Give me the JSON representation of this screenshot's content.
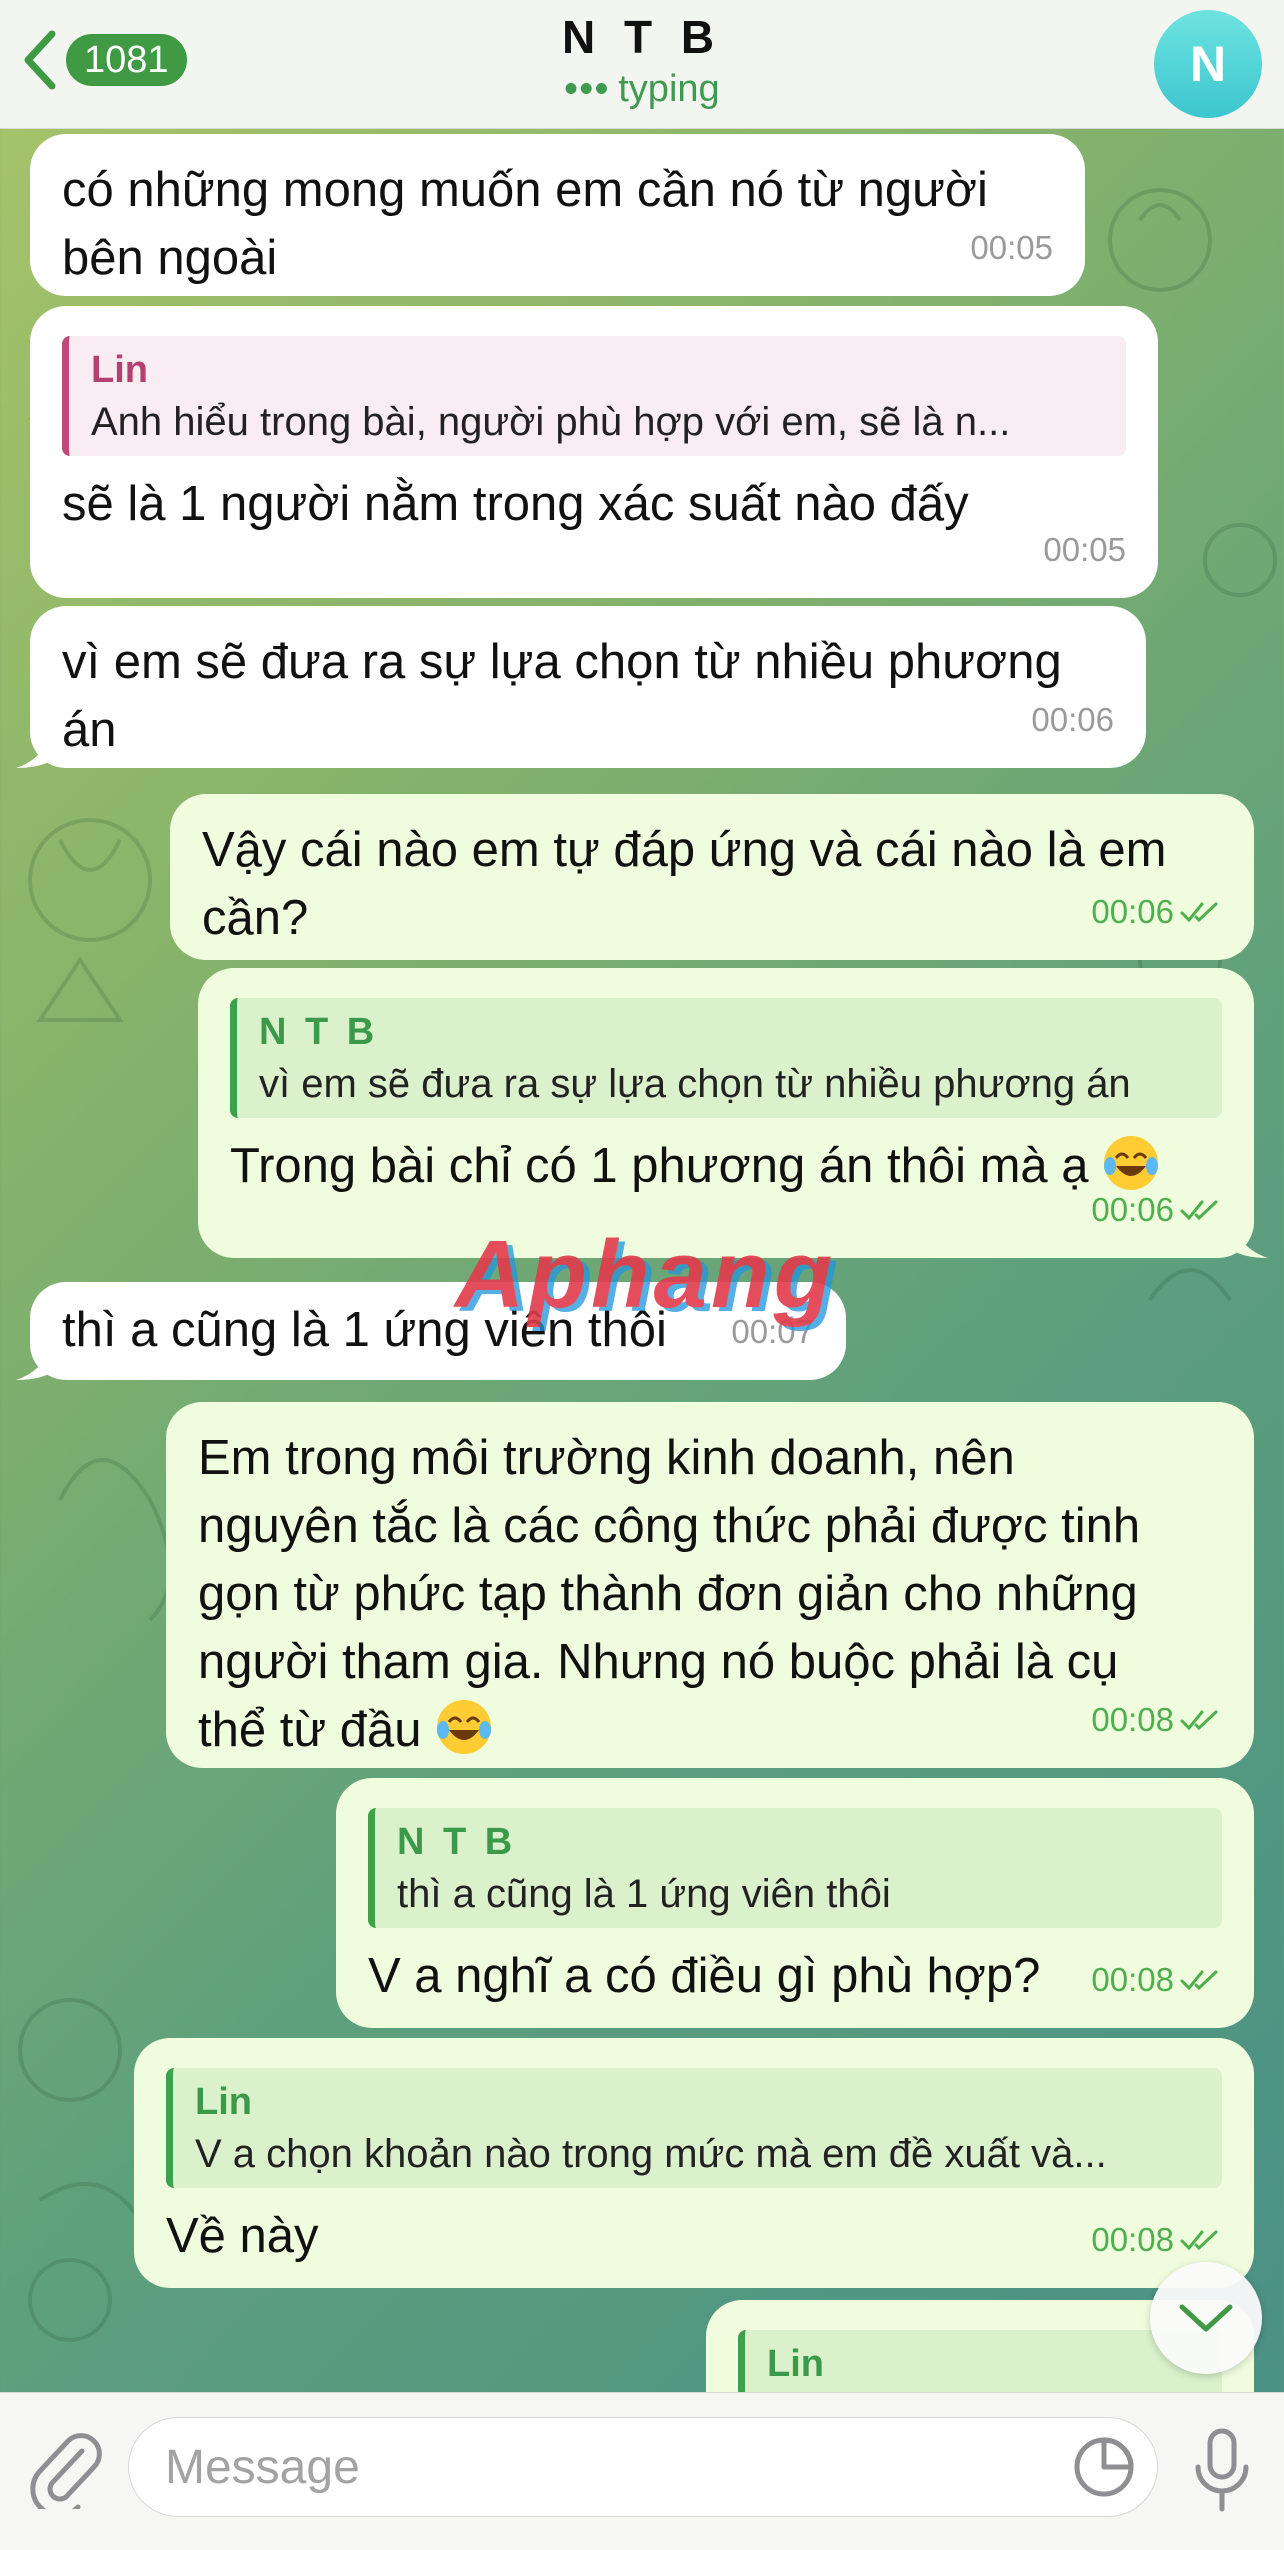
{
  "header": {
    "back_count": "1081",
    "title": "N T B",
    "status": "typing",
    "avatar_letter": "N"
  },
  "messages": [
    {
      "id": 0,
      "side": "in",
      "text_lines": [
        "có những mong muốn em cần nó từ người",
        "bên ngoài"
      ],
      "time": "00:05"
    },
    {
      "id": 1,
      "side": "in",
      "quote": {
        "name": "Lin",
        "text": "Anh hiểu trong bài, người phù hợp với em, sẽ là n..."
      },
      "text": "sẽ là 1 người nằm trong xác suất nào đấy",
      "time": "00:05"
    },
    {
      "id": 2,
      "side": "in",
      "text_lines": [
        "vì em sẽ đưa ra sự lựa chọn từ nhiều phương",
        "án"
      ],
      "time": "00:06"
    },
    {
      "id": 3,
      "side": "out",
      "text_lines": [
        "Vậy cái nào em tự đáp ứng và cái nào là em",
        "cần?"
      ],
      "time": "00:06"
    },
    {
      "id": 4,
      "side": "out",
      "quote": {
        "name": "N T B",
        "text": "vì em sẽ đưa ra sự lựa chọn từ nhiều phương án"
      },
      "text": "Trong bài chỉ có 1 phương án thôi mà ạ",
      "emoji": "tears-of-joy",
      "time": "00:06"
    },
    {
      "id": 5,
      "side": "in",
      "text": "thì a cũng là 1 ứng viên thôi",
      "time": "00:07"
    },
    {
      "id": 6,
      "side": "out",
      "text_lines": [
        "Em trong môi trường kinh doanh, nên",
        "nguyên tắc là các công thức phải được tinh",
        "gọn từ phức tạp thành đơn giản cho những",
        "người tham gia. Nhưng nó buộc phải là cụ",
        "thể từ đầu"
      ],
      "emoji": "tears-of-joy",
      "time": "00:08"
    },
    {
      "id": 7,
      "side": "out",
      "quote": {
        "name": "N T B",
        "text": "thì a cũng là 1 ứng viên thôi"
      },
      "text": "V a nghĩ a có điều gì phù hợp?",
      "time": "00:08"
    },
    {
      "id": 8,
      "side": "out",
      "quote": {
        "name": "Lin",
        "text": "V a chọn khoản nào trong mức mà em đề xuất và..."
      },
      "text": "Về này",
      "time": "00:08"
    },
    {
      "id": 9,
      "side": "out",
      "quote": {
        "name": "Lin",
        "text": ""
      },
      "text": ""
    }
  ],
  "watermark": "Aphang",
  "input": {
    "placeholder": "Message"
  },
  "colors": {
    "accent_green": "#3f9a43",
    "incoming_bubble": "#ffffff",
    "outgoing_bubble": "#effdde",
    "quote_pink": "#c0497c"
  },
  "icons": [
    "chevron-left-icon",
    "paperclip-icon",
    "sticker-icon",
    "microphone-icon",
    "chevron-down-icon",
    "double-check-icon"
  ]
}
